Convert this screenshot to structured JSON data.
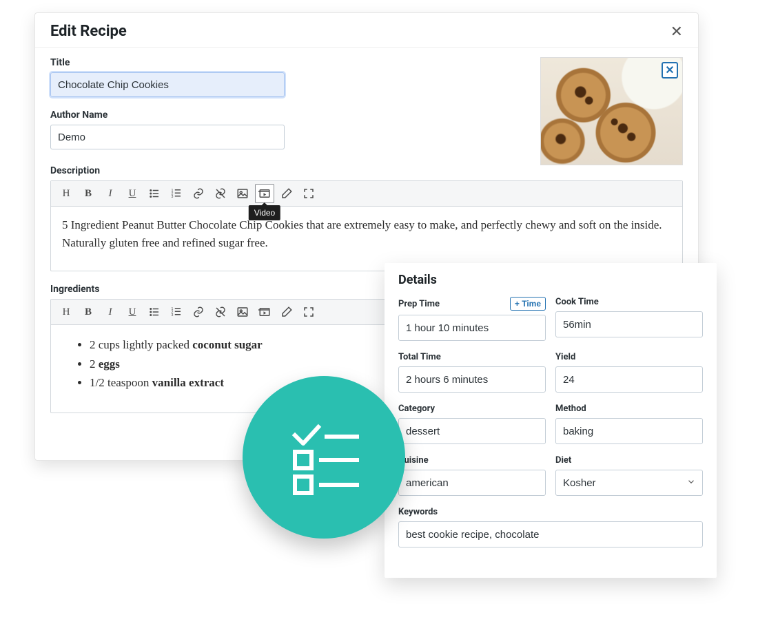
{
  "modal": {
    "title": "Edit Recipe",
    "labels": {
      "title": "Title",
      "author": "Author Name",
      "description": "Description",
      "ingredients": "Ingredients"
    },
    "fields": {
      "title": "Chocolate Chip Cookies",
      "author": "Demo"
    },
    "description_text": "5 Ingredient Peanut Butter Chocolate Chip Cookies that are extremely easy to make, and perfectly chewy and soft on the inside. Naturally gluten free and refined sugar free.",
    "ingredients": [
      {
        "pre": "2 cups lightly packed ",
        "bold": "coconut sugar"
      },
      {
        "pre": "2 ",
        "bold": "eggs"
      },
      {
        "pre": "1/2 teaspoon ",
        "bold": "vanilla extract"
      }
    ],
    "toolbar_tooltip": "Video"
  },
  "details": {
    "heading": "Details",
    "labels": {
      "prep_time": "Prep Time",
      "cook_time": "Cook Time",
      "total_time": "Total Time",
      "yield": "Yield",
      "category": "Category",
      "method": "Method",
      "cuisine": "Cuisine",
      "diet": "Diet",
      "keywords": "Keywords"
    },
    "add_time_label": "+ Time",
    "values": {
      "prep_time": "1 hour 10 minutes",
      "cook_time": "56min",
      "total_time": "2 hours 6 minutes",
      "yield": "24",
      "category": "dessert",
      "method": "baking",
      "cuisine": "american",
      "diet": "Kosher",
      "keywords": "best cookie recipe, chocolate"
    }
  }
}
